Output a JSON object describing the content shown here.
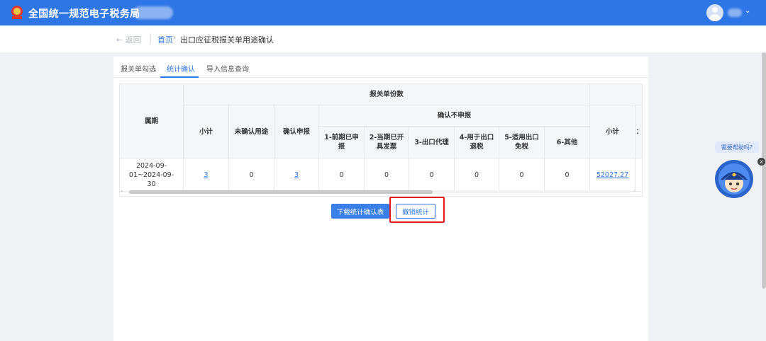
{
  "header": {
    "app_title": "全国统一规范电子税务局",
    "user_dropdown_glyph": "⌄"
  },
  "breadcrumb": {
    "back_label": "← 返回",
    "home": "首页",
    "separator": "›",
    "current": "出口应征税报关单用途确认"
  },
  "tabs": [
    {
      "label": "报关单勾选",
      "active": false
    },
    {
      "label": "统计确认",
      "active": true
    },
    {
      "label": "导入信息查询",
      "active": false
    }
  ],
  "table": {
    "headers": {
      "period": "属期",
      "declaration_count_group": "报关单份数",
      "subtotal": "小计",
      "unconfirmed": "未确认用途",
      "confirmed_declare": "确认申报",
      "confirmed_not_declare_group": "确认不申报",
      "c1": "1-前期已申报",
      "c2": "2-当期已开具发票",
      "c3": "3-出口代理",
      "c4": "4-用于出口退税",
      "c5": "5-适用出口免税",
      "c6": "6-其他",
      "right_subtotal": "小计",
      "right_cut": "："
    },
    "rows": [
      {
        "period": "2024-09-01~2024-09-30",
        "subtotal": "3",
        "unconfirmed": "0",
        "confirmed_declare": "3",
        "c1": "0",
        "c2": "0",
        "c3": "0",
        "c4": "0",
        "c5": "0",
        "c6": "0",
        "right_subtotal": "52027.27"
      }
    ]
  },
  "scroll": {
    "left_arrow": "‹",
    "right_arrow": "›"
  },
  "actions": {
    "download": "下载统计确认表",
    "revoke": "撤销统计"
  },
  "help": {
    "bubble": "需要帮助吗?",
    "close": "x"
  },
  "colors": {
    "brand": "#2e75e6",
    "highlight": "#e02020"
  }
}
